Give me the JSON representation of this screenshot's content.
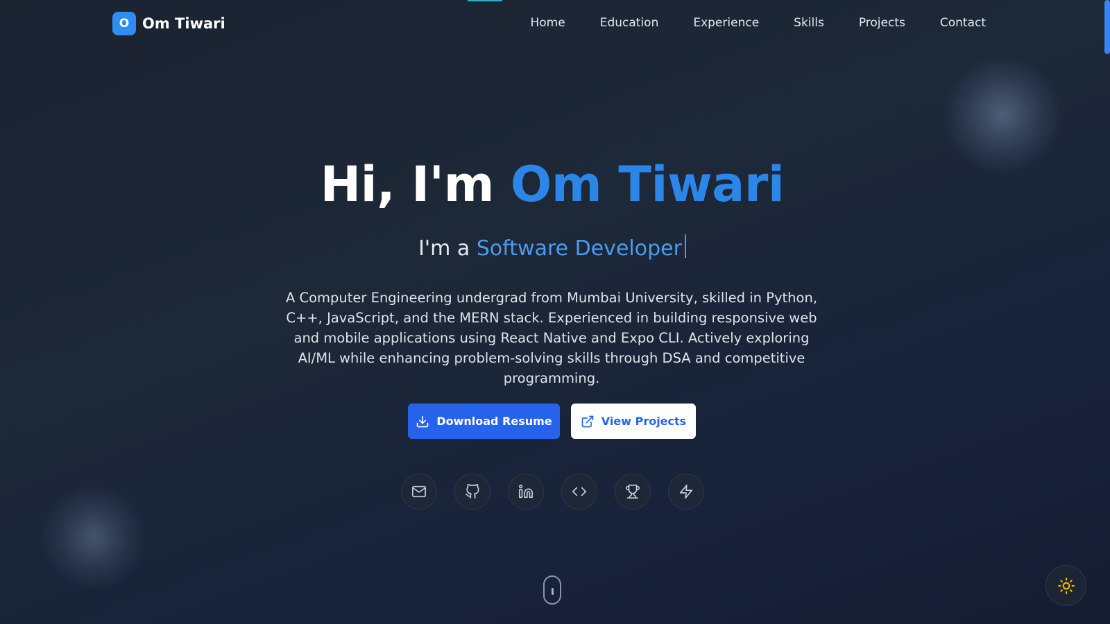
{
  "nav": {
    "logo_letter": "O",
    "logo_name": "Om Tiwari",
    "items": [
      {
        "label": "Home"
      },
      {
        "label": "Education"
      },
      {
        "label": "Experience"
      },
      {
        "label": "Skills"
      },
      {
        "label": "Projects"
      },
      {
        "label": "Contact"
      }
    ]
  },
  "hero": {
    "greeting": "Hi, I'm ",
    "name": "Om Tiwari",
    "sub_prefix": "I'm a ",
    "role": "Software Developer",
    "description": "A Computer Engineering undergrad from Mumbai University, skilled in Python, C++, JavaScript, and the MERN stack. Experienced in building responsive web and mobile applications using React Native and Expo CLI. Actively exploring AI/ML while enhancing problem-solving skills through DSA and competitive programming."
  },
  "buttons": {
    "primary_label": "Download Resume",
    "primary_icon": "download-icon",
    "secondary_label": "View Projects",
    "secondary_icon": "external-link-icon"
  },
  "socials": [
    {
      "icon": "mail-icon"
    },
    {
      "icon": "github-icon"
    },
    {
      "icon": "linkedin-icon"
    },
    {
      "icon": "code-icon"
    },
    {
      "icon": "trophy-icon"
    },
    {
      "icon": "zap-icon"
    }
  ],
  "theme_toggle": {
    "icon": "sun-icon"
  },
  "colors": {
    "accent": "#2b86e8",
    "role": "#4a9cf0",
    "primary_button": "#2563eb",
    "logo_badge": "#2f8cf0",
    "sun": "#f5b400"
  }
}
